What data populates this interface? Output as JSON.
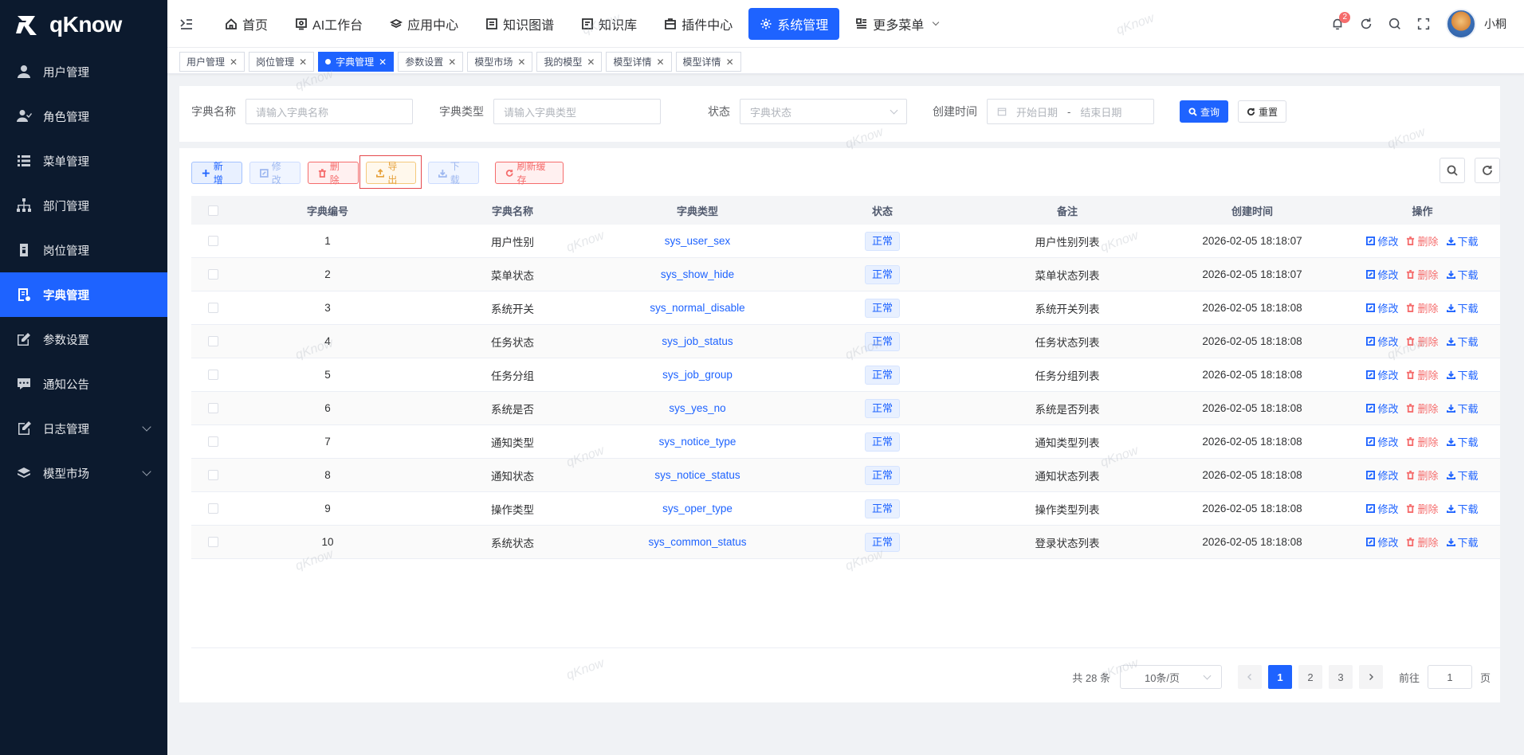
{
  "app": {
    "name": "qKnow"
  },
  "sidebar": {
    "items": [
      {
        "label": "用户管理",
        "icon": "user-icon",
        "active": false
      },
      {
        "label": "角色管理",
        "icon": "role-icon",
        "active": false
      },
      {
        "label": "菜单管理",
        "icon": "menu-list-icon",
        "active": false
      },
      {
        "label": "部门管理",
        "icon": "org-tree-icon",
        "active": false
      },
      {
        "label": "岗位管理",
        "icon": "post-icon",
        "active": false
      },
      {
        "label": "字典管理",
        "icon": "dict-icon",
        "active": true
      },
      {
        "label": "参数设置",
        "icon": "edit-icon",
        "active": false
      },
      {
        "label": "通知公告",
        "icon": "message-icon",
        "active": false
      },
      {
        "label": "日志管理",
        "icon": "log-icon",
        "active": false,
        "expandable": true
      },
      {
        "label": "模型市场",
        "icon": "model-icon",
        "active": false,
        "expandable": true
      }
    ]
  },
  "topnav": {
    "items": [
      {
        "label": "首页",
        "icon": "home-icon"
      },
      {
        "label": "AI工作台",
        "icon": "ai-icon"
      },
      {
        "label": "应用中心",
        "icon": "app-icon"
      },
      {
        "label": "知识图谱",
        "icon": "graph-icon"
      },
      {
        "label": "知识库",
        "icon": "book-icon"
      },
      {
        "label": "插件中心",
        "icon": "plugin-icon"
      },
      {
        "label": "系统管理",
        "icon": "gear-icon",
        "active": true
      },
      {
        "label": "更多菜单",
        "icon": "more-icon"
      }
    ],
    "notification_count": "2",
    "username": "小桐"
  },
  "tags": [
    {
      "label": "用户管理",
      "active": false
    },
    {
      "label": "岗位管理",
      "active": false
    },
    {
      "label": "字典管理",
      "active": true
    },
    {
      "label": "参数设置",
      "active": false
    },
    {
      "label": "模型市场",
      "active": false
    },
    {
      "label": "我的模型",
      "active": false
    },
    {
      "label": "模型详情",
      "active": false
    },
    {
      "label": "模型详情",
      "active": false
    }
  ],
  "search": {
    "dict_name_label": "字典名称",
    "dict_name_placeholder": "请输入字典名称",
    "dict_type_label": "字典类型",
    "dict_type_placeholder": "请输入字典类型",
    "status_label": "状态",
    "status_placeholder": "字典状态",
    "created_label": "创建时间",
    "start_placeholder": "开始日期",
    "date_sep": "-",
    "end_placeholder": "结束日期",
    "query_label": "查询",
    "reset_label": "重置"
  },
  "toolbar": {
    "add": "新增",
    "edit": "修改",
    "delete": "删除",
    "export": "导出",
    "download": "下载",
    "refresh_cache": "刷新缓存"
  },
  "table": {
    "headers": [
      "字典编号",
      "字典名称",
      "字典类型",
      "状态",
      "备注",
      "创建时间",
      "操作"
    ],
    "rows": [
      {
        "id": "1",
        "name": "用户性别",
        "type": "sys_user_sex",
        "status": "正常",
        "remark": "用户性别列表",
        "time": "2026-02-05 18:18:07"
      },
      {
        "id": "2",
        "name": "菜单状态",
        "type": "sys_show_hide",
        "status": "正常",
        "remark": "菜单状态列表",
        "time": "2026-02-05 18:18:07"
      },
      {
        "id": "3",
        "name": "系统开关",
        "type": "sys_normal_disable",
        "status": "正常",
        "remark": "系统开关列表",
        "time": "2026-02-05 18:18:08"
      },
      {
        "id": "4",
        "name": "任务状态",
        "type": "sys_job_status",
        "status": "正常",
        "remark": "任务状态列表",
        "time": "2026-02-05 18:18:08"
      },
      {
        "id": "5",
        "name": "任务分组",
        "type": "sys_job_group",
        "status": "正常",
        "remark": "任务分组列表",
        "time": "2026-02-05 18:18:08"
      },
      {
        "id": "6",
        "name": "系统是否",
        "type": "sys_yes_no",
        "status": "正常",
        "remark": "系统是否列表",
        "time": "2026-02-05 18:18:08"
      },
      {
        "id": "7",
        "name": "通知类型",
        "type": "sys_notice_type",
        "status": "正常",
        "remark": "通知类型列表",
        "time": "2026-02-05 18:18:08"
      },
      {
        "id": "8",
        "name": "通知状态",
        "type": "sys_notice_status",
        "status": "正常",
        "remark": "通知状态列表",
        "time": "2026-02-05 18:18:08"
      },
      {
        "id": "9",
        "name": "操作类型",
        "type": "sys_oper_type",
        "status": "正常",
        "remark": "操作类型列表",
        "time": "2026-02-05 18:18:08"
      },
      {
        "id": "10",
        "name": "系统状态",
        "type": "sys_common_status",
        "status": "正常",
        "remark": "登录状态列表",
        "time": "2026-02-05 18:18:08"
      }
    ],
    "op_edit": "修改",
    "op_delete": "删除",
    "op_download": "下载"
  },
  "pagination": {
    "total": "共 28 条",
    "page_size": "10条/页",
    "pages": [
      "1",
      "2",
      "3"
    ],
    "current": "1",
    "goto_label": "前往",
    "goto_value": "1",
    "page_unit": "页"
  },
  "watermark": "qKnow",
  "colors": {
    "primary": "#1e63ff",
    "sidebar_bg": "#0c1a2e",
    "danger": "#f56c6c",
    "warning": "#e6a23c"
  }
}
